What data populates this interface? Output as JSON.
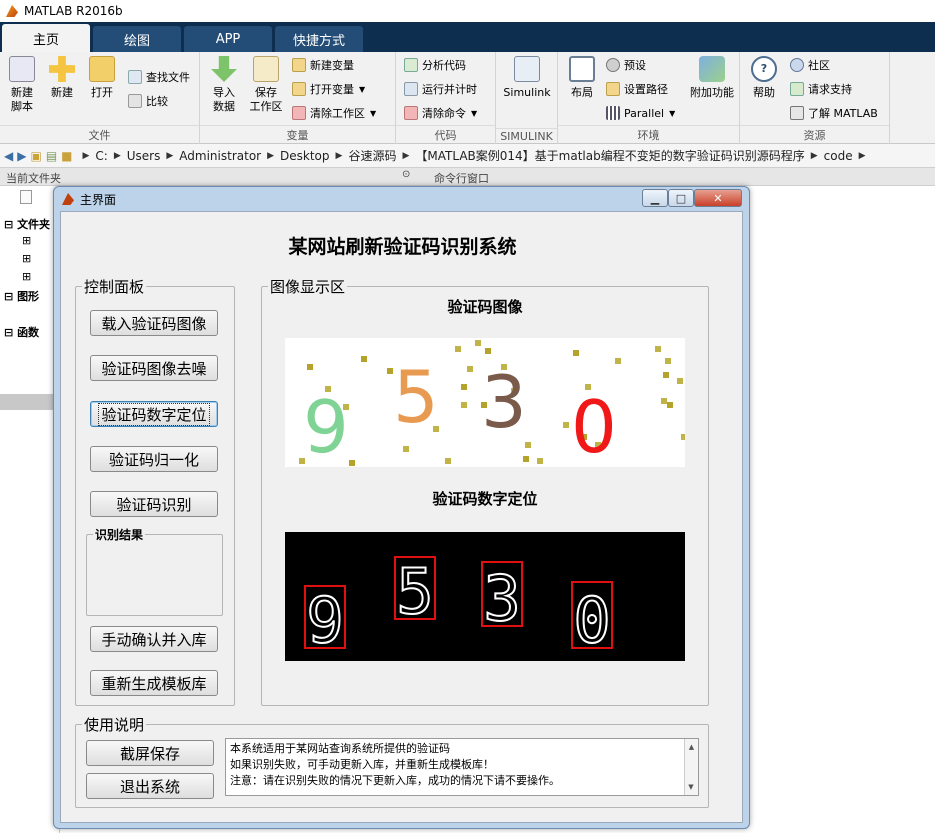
{
  "app": {
    "title": "MATLAB R2016b"
  },
  "ribbon": {
    "tabs": [
      "主页",
      "绘图",
      "APP",
      "快捷方式"
    ],
    "groups": {
      "file": {
        "label": "文件",
        "new_script": "新建\n脚本",
        "new": "新建",
        "open": "打开",
        "find_files": "查找文件",
        "compare": "比较"
      },
      "variable": {
        "label": "变量",
        "import_data": "导入\n数据",
        "save_workspace": "保存\n工作区",
        "new_variable": "新建变量",
        "open_variable": "打开变量",
        "clear_workspace": "清除工作区"
      },
      "code": {
        "label": "代码",
        "analyze": "分析代码",
        "run_time": "运行并计时",
        "clear_cmd": "清除命令"
      },
      "simulink": {
        "label": "SIMULINK",
        "simulink": "Simulink"
      },
      "environment": {
        "label": "环境",
        "layout": "布局",
        "preferences": "预设",
        "set_path": "设置路径",
        "parallel": "Parallel",
        "addons": "附加功能"
      },
      "resources": {
        "label": "资源",
        "help": "帮助",
        "community": "社区",
        "request_support": "请求支持",
        "learn": "了解 MATLAB"
      }
    }
  },
  "address": {
    "segments": [
      "C:",
      "Users",
      "Administrator",
      "Desktop",
      "谷速源码",
      "【MATLAB案例014】基于matlab编程不变矩的数字验证码识别源码程序",
      "code"
    ]
  },
  "panels": {
    "current_folder": "当前文件夹",
    "command_window": "命令行窗口",
    "folders": "文件夹",
    "figures": "图形",
    "functions": "函数"
  },
  "gui": {
    "window_title": "主界面",
    "title": "某网站刷新验证码识别系统",
    "control_panel": "控制面板",
    "buttons": {
      "load": "载入验证码图像",
      "denoise": "验证码图像去噪",
      "locate": "验证码数字定位",
      "normalize": "验证码归一化",
      "recognize": "验证码识别",
      "confirm_save": "手动确认并入库",
      "regen_templates": "重新生成模板库",
      "screenshot_save": "截屏保存",
      "exit": "退出系统"
    },
    "result_label": "识别结果",
    "display_area": "图像显示区",
    "image1_label": "验证码图像",
    "image2_label": "验证码数字定位",
    "captcha_digits": [
      "9",
      "5",
      "3",
      "0"
    ],
    "digit_colors": [
      "#7fd394",
      "#e89a50",
      "#7a5a4a",
      "#f01818"
    ],
    "instructions_label": "使用说明",
    "instructions": [
      "本系统适用于某网站查询系统所提供的验证码",
      "如果识别失败，可手动更新入库，并重新生成模板库！",
      "注意：请在识别失败的情况下更新入库，成功的情况下请不要操作。"
    ]
  }
}
